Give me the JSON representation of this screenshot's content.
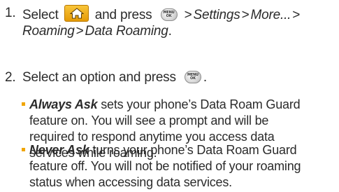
{
  "steps": [
    {
      "number": "1.",
      "select_label": "Select",
      "and_press_label": "and press",
      "path": [
        "Settings",
        "More...",
        "Roaming",
        "Data Roaming"
      ],
      "separator": ">",
      "end": "."
    },
    {
      "number": "2.",
      "text": "Select an option and press",
      "end": "."
    }
  ],
  "icons": {
    "home": "home-icon",
    "menu_ok": "menu-ok-key-icon",
    "menu_key_line1": "MENU",
    "menu_key_line2": "OK"
  },
  "options": [
    {
      "term": "Always Ask",
      "lines": [
        "sets your phone’s Data Roam Guard",
        "feature on. You will see a prompt and will be",
        "required to respond anytime you access data",
        "services while roaming."
      ]
    },
    {
      "term": "Never Ask",
      "lines": [
        "turns your phone’s Data Roam Guard",
        "feature off. You will not be notified of your roaming",
        "status when accessing data services."
      ]
    }
  ],
  "colors": {
    "text": "#2b2b2b",
    "bullet": "#f0a500",
    "home_icon_bg": "#f0a500"
  }
}
